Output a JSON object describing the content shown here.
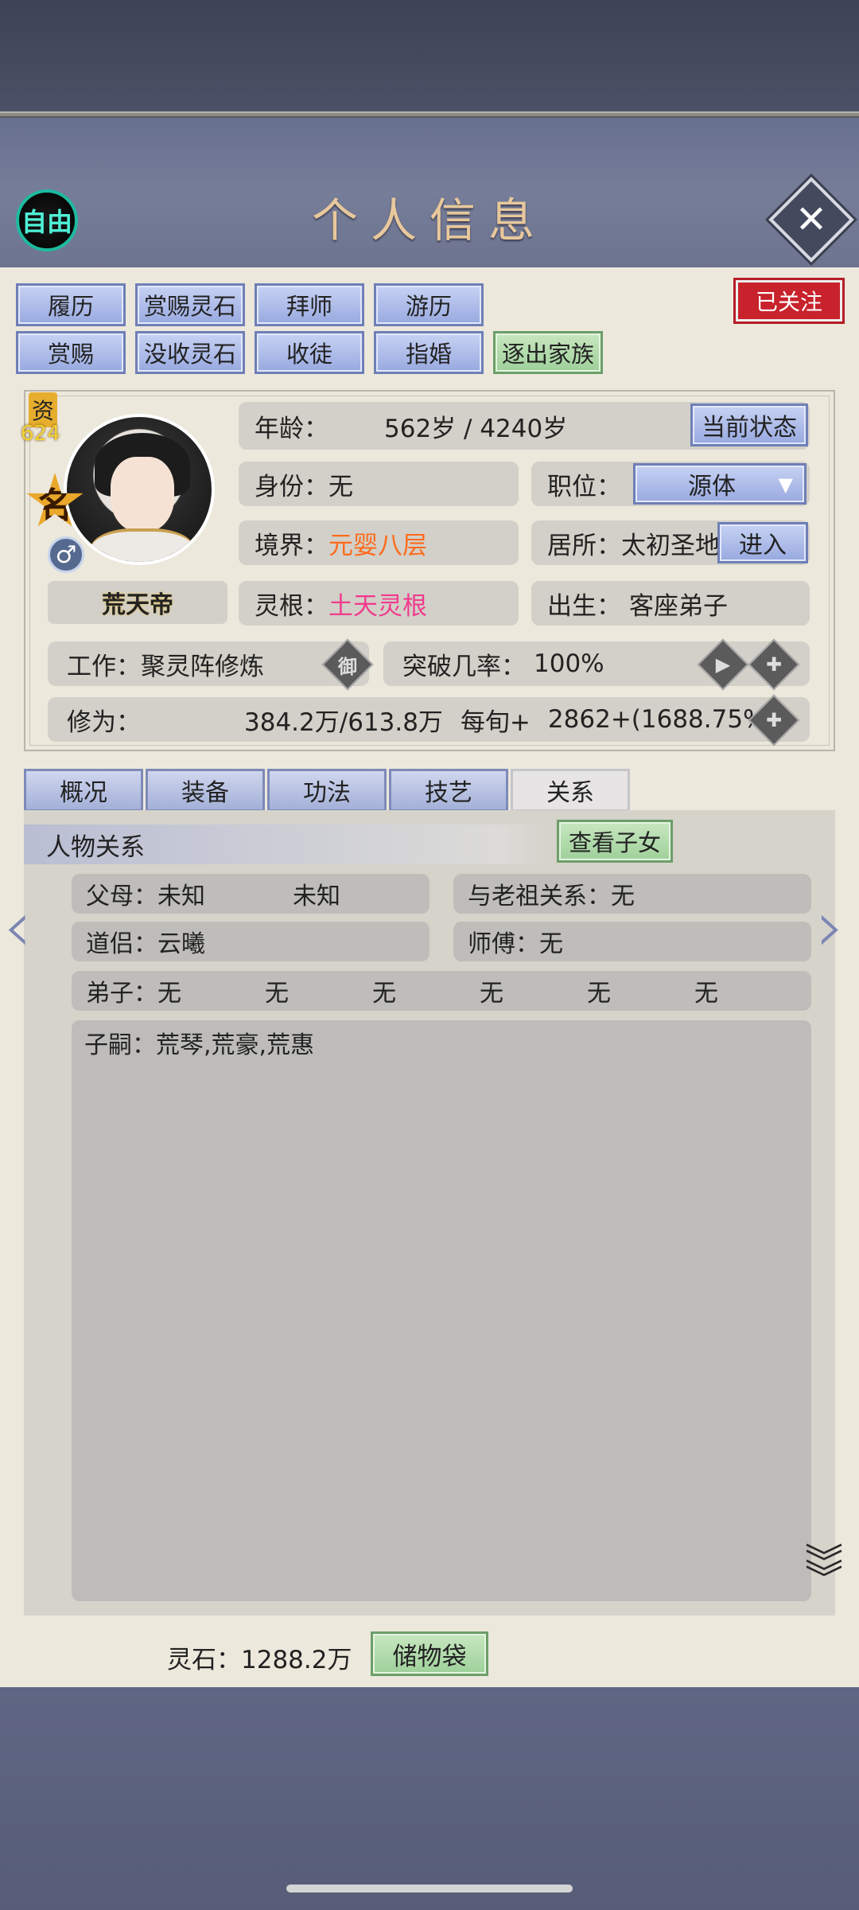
{
  "header": {
    "title": "个人信息",
    "mode_label": "自由",
    "close_icon": "close-icon"
  },
  "action_buttons": {
    "row1": [
      "履历",
      "赏赐灵石",
      "拜师",
      "游历"
    ],
    "row2": [
      "赏赐",
      "没收灵石",
      "收徒",
      "指婚"
    ],
    "expel": "逐出家族",
    "follow": "已关注"
  },
  "profile": {
    "zi_label": "资",
    "zi_value": "624",
    "name_badge": "名",
    "gender_symbol": "♂",
    "name": "荒天帝",
    "age_label": "年龄：",
    "age_value": "562岁 / 4240岁",
    "status_button": "当前状态",
    "identity_label": "身份：",
    "identity_value": "无",
    "position_label": "职位：",
    "position_value": "源体",
    "realm_label": "境界：",
    "realm_value": "元婴八层",
    "residence_label": "居所：",
    "residence_value": "太初圣地",
    "enter_button": "进入",
    "root_label": "灵根：",
    "root_value": "土天灵根",
    "birth_label": "出生：",
    "birth_value": "客座弟子",
    "work_label": "工作：",
    "work_value": "聚灵阵修炼",
    "work_icon_text": "御",
    "breakthrough_label": "突破几率：",
    "breakthrough_value": "100%",
    "cultivation_label": "修为：",
    "cultivation_value": "384.2万/613.8万",
    "per_turn_label": "每旬+",
    "per_turn_value": "2862+(1688.75%)"
  },
  "tabs": [
    "概况",
    "装备",
    "功法",
    "技艺",
    "关系"
  ],
  "active_tab": "关系",
  "relations": {
    "section_title": "人物关系",
    "view_children_button": "查看子女",
    "parents_label": "父母：",
    "parent1": "未知",
    "parent2": "未知",
    "ancestor_label": "与老祖关系：",
    "ancestor_value": "无",
    "partner_label": "道侣：",
    "partner_value": "云曦",
    "master_label": "师傅：",
    "master_value": "无",
    "disciples_label": "弟子：",
    "disciples": [
      "无",
      "无",
      "无",
      "无",
      "无",
      "无"
    ],
    "children_label": "子嗣：",
    "children_value": "荒琴,荒豪,荒惠"
  },
  "footer": {
    "spirit_stone_label": "灵石：",
    "spirit_stone_value": "1288.2万",
    "storage_button": "储物袋"
  }
}
